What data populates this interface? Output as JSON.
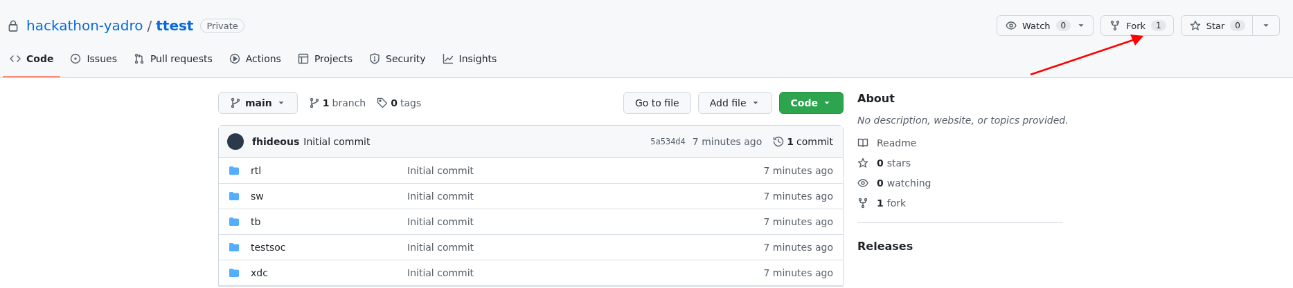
{
  "repo": {
    "owner": "hackathon-yadro",
    "separator": "/",
    "name": "ttest",
    "visibility": "Private"
  },
  "actions": [
    {
      "kind": "watch",
      "label": "Watch",
      "count": "0",
      "dropdown": true
    },
    {
      "kind": "fork",
      "label": "Fork",
      "count": "1",
      "dropdown": false
    },
    {
      "kind": "star",
      "label": "Star",
      "count": "0",
      "dropdown": true
    }
  ],
  "tabs": [
    {
      "label": "Code",
      "selected": true
    },
    {
      "label": "Issues",
      "selected": false
    },
    {
      "label": "Pull requests",
      "selected": false
    },
    {
      "label": "Actions",
      "selected": false
    },
    {
      "label": "Projects",
      "selected": false
    },
    {
      "label": "Security",
      "selected": false
    },
    {
      "label": "Insights",
      "selected": false
    }
  ],
  "branch_bar": {
    "branch": "main",
    "branches": {
      "count": "1",
      "label": "branch"
    },
    "tags": {
      "count": "0",
      "label": "tags"
    },
    "buttons": [
      {
        "kind": "plain",
        "label": "Go to file",
        "dropdown": false
      },
      {
        "kind": "plain",
        "label": "Add file",
        "dropdown": true
      },
      {
        "kind": "primary",
        "label": "Code",
        "dropdown": true
      }
    ]
  },
  "latest_commit": {
    "author": "fhideous",
    "message": "Initial commit",
    "hash": "5a534d4",
    "time": "7 minutes ago",
    "commits": {
      "count": "1",
      "label": "commit"
    }
  },
  "files": [
    {
      "name": "rtl",
      "message": "Initial commit",
      "time": "7 minutes ago"
    },
    {
      "name": "sw",
      "message": "Initial commit",
      "time": "7 minutes ago"
    },
    {
      "name": "tb",
      "message": "Initial commit",
      "time": "7 minutes ago"
    },
    {
      "name": "testsoc",
      "message": "Initial commit",
      "time": "7 minutes ago"
    },
    {
      "name": "xdc",
      "message": "Initial commit",
      "time": "7 minutes ago"
    }
  ],
  "about": {
    "title": "About",
    "description": "No description, website, or topics provided.",
    "items": [
      {
        "label": "Readme"
      },
      {
        "count": "0",
        "label": "stars"
      },
      {
        "count": "0",
        "label": "watching"
      },
      {
        "count": "1",
        "label": "fork"
      }
    ]
  },
  "releases": {
    "title": "Releases"
  },
  "annotation": {
    "kind": "arrow"
  }
}
